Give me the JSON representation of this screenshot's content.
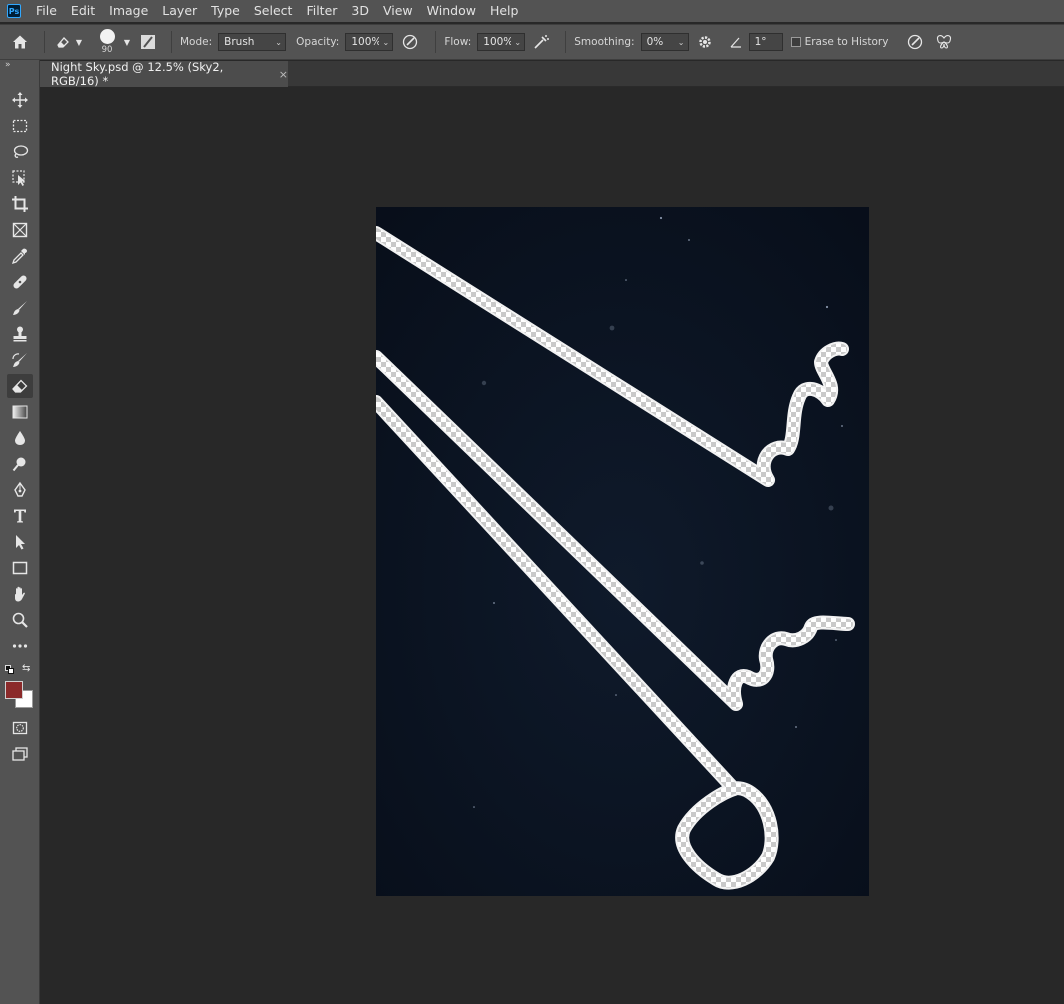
{
  "app": {
    "logo": "Ps"
  },
  "menu": [
    "File",
    "Edit",
    "Image",
    "Layer",
    "Type",
    "Select",
    "Filter",
    "3D",
    "View",
    "Window",
    "Help"
  ],
  "options": {
    "brush_size": "90",
    "mode_label": "Mode:",
    "mode_value": "Brush",
    "opacity_label": "Opacity:",
    "opacity_value": "100%",
    "flow_label": "Flow:",
    "flow_value": "100%",
    "smoothing_label": "Smoothing:",
    "smoothing_value": "0%",
    "angle_value": "1°",
    "erase_history_label": "Erase to History",
    "erase_history_checked": false
  },
  "document": {
    "tab_title": "Night Sky.psd @ 12.5% (Sky2, RGB/16) *",
    "close_glyph": "×"
  },
  "toolbar": {
    "active_tool": "eraser-tool",
    "foreground_color": "#8b2a2a",
    "background_color": "#ffffff",
    "tools": [
      "move-tool",
      "rectangular-marquee-tool",
      "lasso-tool",
      "object-selection-tool",
      "crop-tool",
      "frame-tool",
      "eyedropper-tool",
      "spot-healing-brush-tool",
      "brush-tool",
      "clone-stamp-tool",
      "history-brush-tool",
      "eraser-tool",
      "gradient-tool",
      "blur-tool",
      "dodge-tool",
      "pen-tool",
      "type-tool",
      "path-selection-tool",
      "rectangle-tool",
      "hand-tool",
      "zoom-tool",
      "edit-toolbar",
      "quick-mask",
      "screen-mode"
    ]
  },
  "canvas": {
    "background_color": "#0b1322"
  }
}
